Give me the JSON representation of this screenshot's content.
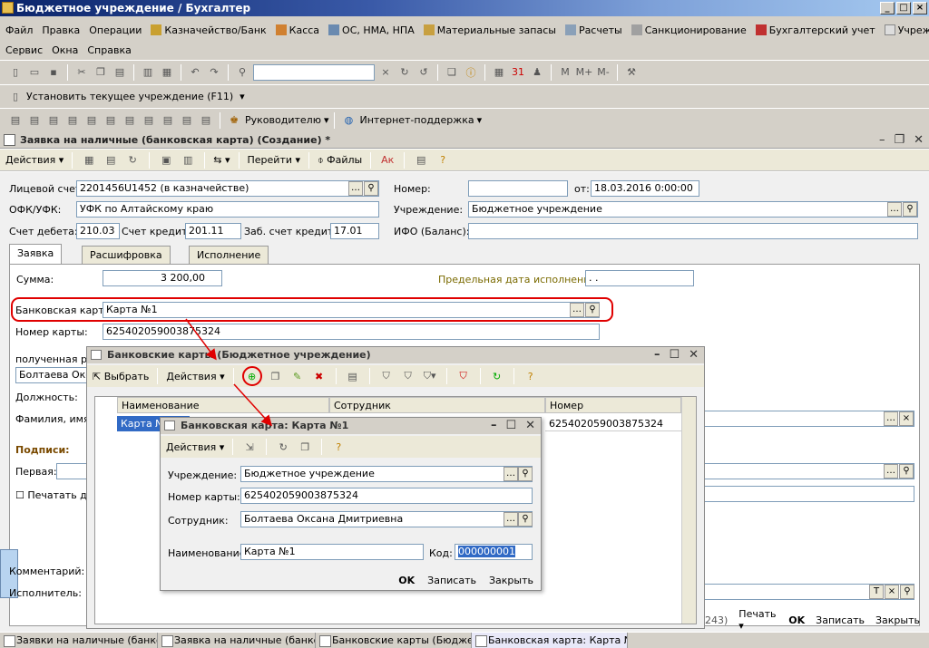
{
  "app": {
    "title": "Бюджетное учреждение / Бухгалтер"
  },
  "menu1": [
    "Файл",
    "Правка",
    "Операции",
    "Казначейство/Банк",
    "Касса",
    "ОС, НМА, НПА",
    "Материальные запасы",
    "Расчеты",
    "Санкционирование",
    "Бухгалтерский учет",
    "Учреждение"
  ],
  "menu2": [
    "Сервис",
    "Окна",
    "Справка"
  ],
  "toolbar3": {
    "set_org": "Установить текущее учреждение (F11)"
  },
  "toolbar4": {
    "managers": "Руководителю",
    "support": "Интернет-поддержка"
  },
  "doc": {
    "title": "Заявка на наличные (банковская карта) (Создание) *",
    "actions": "Действия",
    "goto": "Перейти",
    "files": "Файлы",
    "acc_label": "Лицевой счет:",
    "acc_value": "2201456U1452 (в казначействе)",
    "num_label": "Номер:",
    "num_value": "",
    "from_label": "от:",
    "date_value": "18.03.2016  0:00:00",
    "ofk_label": "ОФК/УФК:",
    "ofk_value": "УФК по Алтайскому краю",
    "org_label": "Учреждение:",
    "org_value": "Бюджетное учреждение",
    "debit_label": "Счет дебета:",
    "debit_value": "210.03",
    "credit_label": "Счет кредита:",
    "credit_value": "201.11",
    "offbal_label": "Заб. счет кредита:",
    "offbal_value": "17.01",
    "ifo_label": "ИФО (Баланс):",
    "ifo_value": "",
    "tabs": [
      "Заявка",
      "Расшифровка",
      "Исполнение"
    ],
    "sum_label": "Сумма:",
    "sum_value": "3 200,00",
    "deadline_label": "Предельная дата исполнения:",
    "deadline_value": " .  .",
    "card_label": "Банковская карта:",
    "card_value": "Карта №1",
    "cardnum_label": "Номер карты:",
    "cardnum_value": "625402059003875324",
    "recv_label": "полученная ра",
    "recv_value": "Болтаева Окс",
    "post_label": "Должность:",
    "fio_label": "Фамилия, имя",
    "sign_label": "Подписи:",
    "first_label": "Первая:",
    "print_label": "Печатать до",
    "comment_label": "Комментарий:",
    "exec_label": "Исполнитель:",
    "bottom_suffix": "1243)",
    "print_btn": "Печать",
    "ok": "OK",
    "save": "Записать",
    "close": "Закрыть"
  },
  "cards": {
    "title": "Банковские карты (Бюджетное учреждение)",
    "select": "Выбрать",
    "actions": "Действия",
    "cols": [
      "Наименование",
      "Сотрудник",
      "Номер"
    ],
    "row": {
      "name": "Карта №",
      "number": "625402059003875324"
    }
  },
  "card": {
    "title": "Банковская карта: Карта №1",
    "actions": "Действия",
    "org_label": "Учреждение:",
    "org_value": "Бюджетное учреждение",
    "num_label": "Номер карты:",
    "num_value": "625402059003875324",
    "emp_label": "Сотрудник:",
    "emp_value": "Болтаева Оксана Дмитриевна",
    "name_label": "Наименование:",
    "name_value": "Карта №1",
    "code_label": "Код:",
    "code_value": "000000001",
    "ok": "OK",
    "save": "Записать",
    "close": "Закрыть"
  },
  "taskbar": [
    "Заявки на наличные (банко...",
    "Заявка на наличные (банко...",
    "Банковские карты (Бюджет...",
    "Банковская карта: Карта №1"
  ],
  "colors": {
    "highlight": "#e00000",
    "select": "#316ac5"
  }
}
